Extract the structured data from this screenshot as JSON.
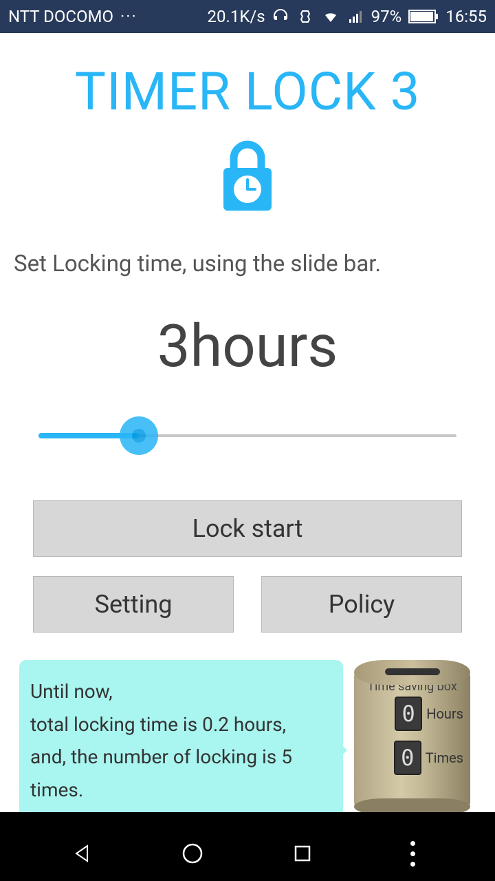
{
  "status_bar": {
    "carrier": "NTT DOCOMO",
    "speed": "20.1K/s",
    "battery": "97%",
    "time": "16:55"
  },
  "app_title": "TIMER LOCK 3",
  "instruction": "Set Locking time, using the slide bar.",
  "time_display": "3hours",
  "buttons": {
    "lock_start": "Lock start",
    "setting": "Setting",
    "policy": "Policy"
  },
  "stats_bubble": {
    "line1": "Until now,",
    "line2": "total locking time is 0.2 hours,",
    "line3": "and, the number of locking is 5 times."
  },
  "savings_box": {
    "title": "Time saving box",
    "hours_value": "0",
    "hours_unit": "Hours",
    "times_value": "0",
    "times_unit": "Times"
  },
  "colors": {
    "accent": "#29b6f6",
    "bubble": "#a9f5ef",
    "statusbar": "#273a5b",
    "button": "#d7d7d7"
  }
}
